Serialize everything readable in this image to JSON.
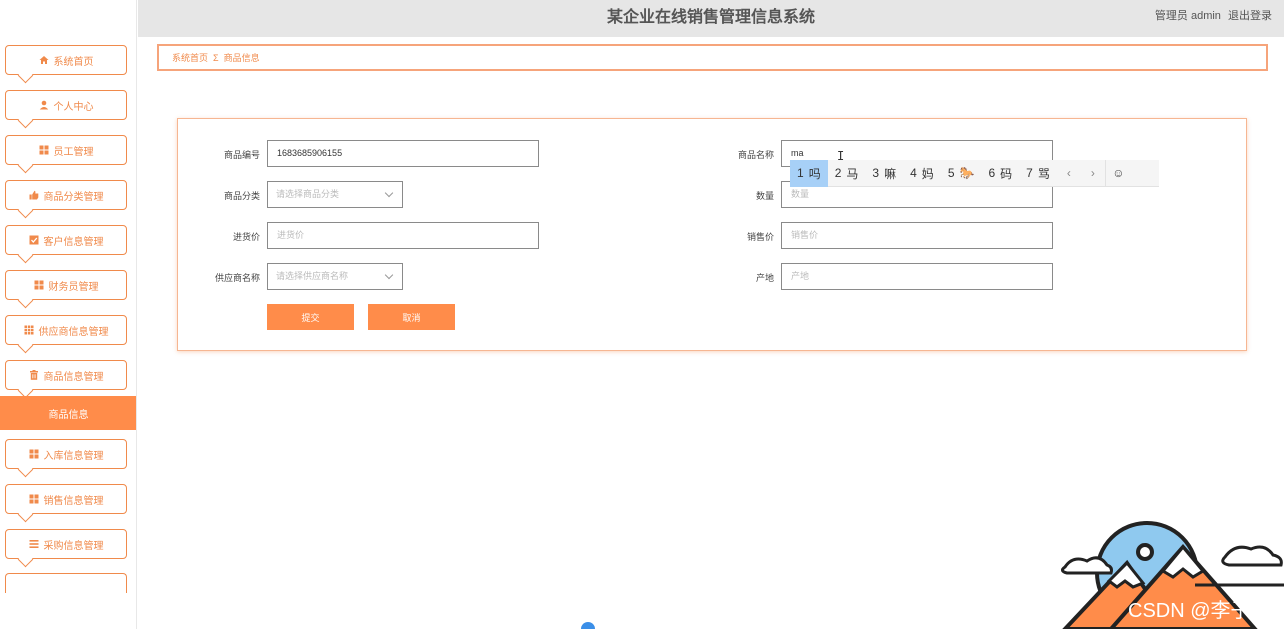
{
  "header": {
    "title": "某企业在线销售管理信息系统",
    "user_role": "管理员 admin",
    "logout": "退出登录"
  },
  "sidebar": {
    "items": [
      {
        "label": "系统首页",
        "icon": "home-icon"
      },
      {
        "label": "个人中心",
        "icon": "person-icon"
      },
      {
        "label": "员工管理",
        "icon": "grid-icon"
      },
      {
        "label": "商品分类管理",
        "icon": "thumb-icon"
      },
      {
        "label": "客户信息管理",
        "icon": "check-square-icon"
      },
      {
        "label": "财务员管理",
        "icon": "grid-icon"
      },
      {
        "label": "供应商信息管理",
        "icon": "table-icon"
      },
      {
        "label": "商品信息管理",
        "icon": "trash-icon"
      },
      {
        "label": "入库信息管理",
        "icon": "grid-icon"
      },
      {
        "label": "销售信息管理",
        "icon": "grid-icon"
      },
      {
        "label": "采购信息管理",
        "icon": "list-icon"
      }
    ],
    "active_item": "商品信息"
  },
  "breadcrumb": {
    "home": "系统首页",
    "separator": "Σ",
    "current": "商品信息"
  },
  "form": {
    "product_code": {
      "label": "商品编号",
      "value": "1683685906155"
    },
    "product_name": {
      "label": "商品名称",
      "value": "ma"
    },
    "category": {
      "label": "商品分类",
      "placeholder": "请选择商品分类"
    },
    "quantity": {
      "label": "数量",
      "placeholder": "数量"
    },
    "purchase_price": {
      "label": "进货价",
      "placeholder": "进货价"
    },
    "sale_price": {
      "label": "销售价",
      "placeholder": "销售价"
    },
    "supplier": {
      "label": "供应商名称",
      "placeholder": "请选择供应商名称"
    },
    "origin": {
      "label": "产地",
      "placeholder": "产地"
    },
    "submit": "提交",
    "cancel": "取消"
  },
  "ime": {
    "candidates": [
      {
        "n": "1",
        "text": "吗"
      },
      {
        "n": "2",
        "text": "马"
      },
      {
        "n": "3",
        "text": "嘛"
      },
      {
        "n": "4",
        "text": "妈"
      },
      {
        "n": "5",
        "text": "🐎"
      },
      {
        "n": "6",
        "text": "码"
      },
      {
        "n": "7",
        "text": "骂"
      }
    ],
    "prev": "‹",
    "next": "›",
    "emoji": "☺"
  },
  "watermark": "CSDN @李子c",
  "colors": {
    "accent": "#ff8c4a",
    "border": "#f6a47b",
    "header_bg": "#e6e6e6",
    "ime_selected": "#a7d0f7"
  }
}
